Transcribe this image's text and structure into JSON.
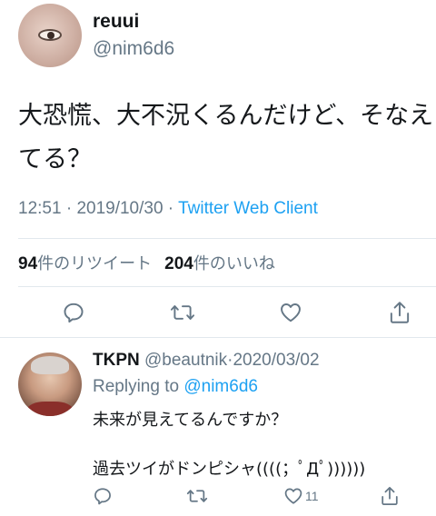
{
  "main_tweet": {
    "display_name": "reuui",
    "handle": "@nim6d6",
    "text_line1": "大恐慌、大不況くるんだけど、そなえ",
    "text_line2": "てる？",
    "time": "12:51",
    "date": "2019/10/30",
    "sep1": " · ",
    "sep2": " · ",
    "client": "Twitter Web Client",
    "retweet_count": "94",
    "retweet_label": "件のリツイート",
    "like_count": "204",
    "like_label": "件のいいね"
  },
  "reply": {
    "display_name": "TKPN",
    "handle": "@beautnik",
    "date_sep": "·",
    "date": "2020/03/02",
    "replying_prefix": "Replying to ",
    "replying_to": "@nim6d6",
    "text_line1": "未来が見えてるんですか？",
    "text_line2": "過去ツイがドンピシャ((((；ﾟДﾟ))))))",
    "like_count": "11"
  },
  "icons": {
    "reply": "reply-icon",
    "retweet": "retweet-icon",
    "like": "heart-icon",
    "share": "share-icon"
  },
  "colors": {
    "link": "#1da1f2",
    "secondary": "#657786",
    "text": "#14171a",
    "divider": "#e1e8ed"
  }
}
